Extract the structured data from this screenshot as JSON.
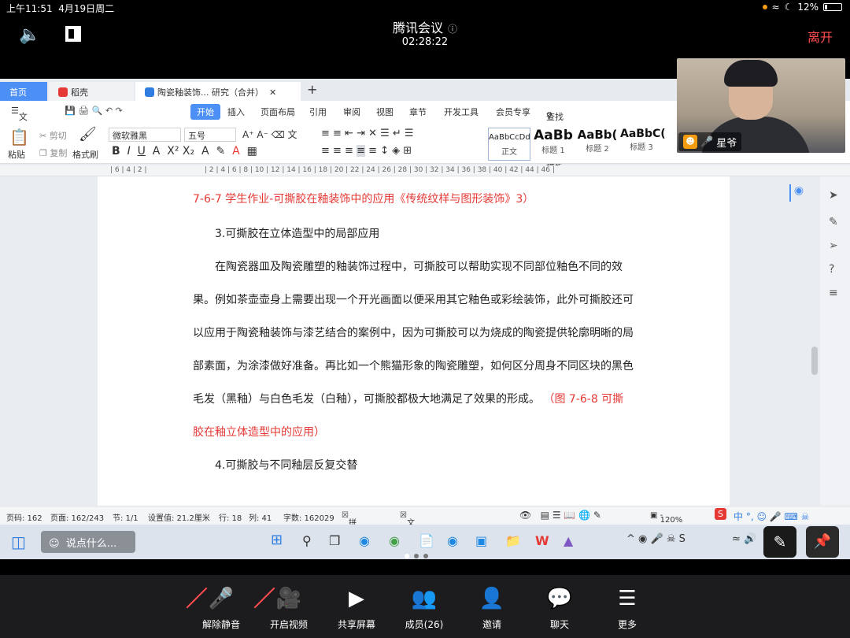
{
  "status_bar": {
    "time": "上午11:51",
    "date": "4月19日周二",
    "battery": "12%"
  },
  "meeting": {
    "title": "腾讯会议",
    "timer": "02:28:22",
    "leave_label": "离开",
    "presenter_name": "星爷"
  },
  "wps": {
    "tabs": [
      {
        "label": "首页"
      },
      {
        "label": "稻壳"
      },
      {
        "label": "陶瓷釉装饰... 研究（合并）"
      }
    ],
    "menu": [
      "文件",
      "开始",
      "插入",
      "页面布局",
      "引用",
      "审阅",
      "视图",
      "章节",
      "开发工具",
      "会员专享"
    ],
    "search_placeholder": "查找命令、搜索模板",
    "ribbon": {
      "paste": "粘贴",
      "cut": "剪切",
      "copy": "复制",
      "format_painter": "格式刷",
      "font_name": "微软雅黑",
      "font_size": "五号",
      "styles": [
        {
          "preview": "AaBbCcDd",
          "name": "正文"
        },
        {
          "preview": "AaBb",
          "name": "标题 1"
        },
        {
          "preview": "AaBb(",
          "name": "标题 2"
        },
        {
          "preview": "AaBbC(",
          "name": "标题 3"
        }
      ]
    },
    "document": {
      "red_line": "7-6-7 学生作业-可撕胶在釉装饰中的应用《传统纹样与图形装饰》3）",
      "heading3": "3.可撕胶在立体造型中的局部应用",
      "body_lines": [
        "在陶瓷器皿及陶瓷雕塑的釉装饰过程中，可撕胶可以帮助实现不同部位釉色不同的效",
        "果。例如茶壶壶身上需要出现一个开光画面以便采用其它釉色或彩绘装饰，此外可撕胶还可",
        "以应用于陶瓷釉装饰与漆艺结合的案例中，因为可撕胶可以为烧成的陶瓷提供轮廓明晰的局",
        "部素面，为涂漆做好准备。再比如一个熊猫形象的陶瓷雕塑，如何区分周身不同区块的黑色"
      ],
      "last_line_black": "毛发（黑釉）与白色毛发（白釉），可撕胶都极大地满足了效果的形成。",
      "last_line_red": "（图 7-6-8 可撕",
      "red_tail": "胶在釉立体造型中的应用）",
      "heading4": "4.可撕胶与不同釉层反复交替"
    },
    "status": {
      "page_code": "页码: 162",
      "page": "页面: 162/243",
      "section": "节: 1/1",
      "setting": "设置值: 21.2厘米",
      "row": "行: 18",
      "col": "列: 41",
      "word_count": "字数: 162029",
      "spell_check": "拼写检查",
      "doc_check": "文档校对",
      "zoom": "120%"
    }
  },
  "windows_taskbar": {
    "search_placeholder": "说点什么..."
  },
  "toolbar": [
    {
      "icon": "mic-off-icon",
      "label": "解除静音"
    },
    {
      "icon": "video-off-icon",
      "label": "开启视频"
    },
    {
      "icon": "share-screen-icon",
      "label": "共享屏幕"
    },
    {
      "icon": "members-icon",
      "label": "成员(26)"
    },
    {
      "icon": "invite-icon",
      "label": "邀请"
    },
    {
      "icon": "chat-icon",
      "label": "聊天"
    },
    {
      "icon": "more-icon",
      "label": "更多"
    }
  ]
}
